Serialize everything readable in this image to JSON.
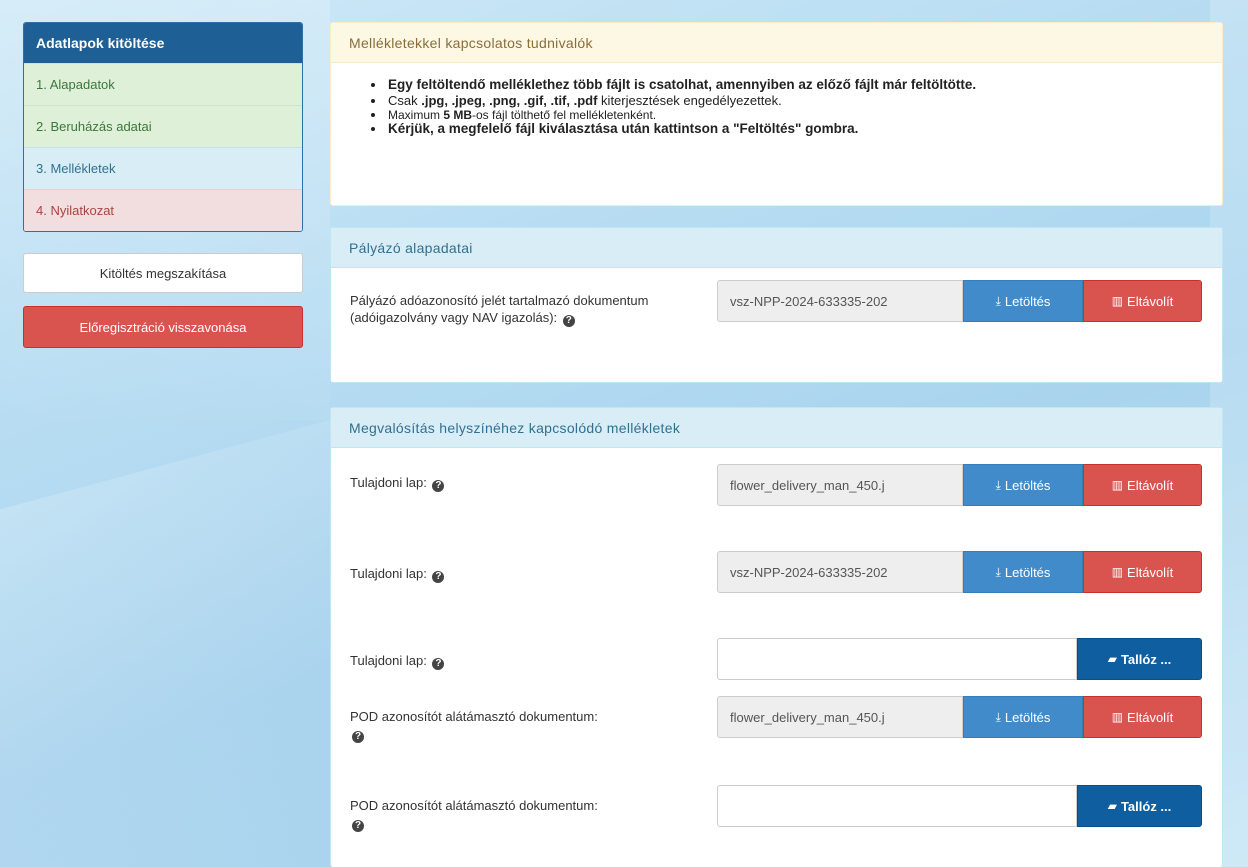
{
  "sidebar": {
    "header": "Adatlapok kitöltése",
    "steps": [
      "1. Alapadatok",
      "2. Beruházás adatai",
      "3. Mellékletek",
      "4. Nyilatkozat"
    ],
    "stop_button": "Kitöltés megszakítása",
    "revoke_button": "Előregisztráció visszavonása"
  },
  "info": {
    "title": "Mellékletekkel kapcsolatos tudnivalók",
    "item1": "Egy feltöltendő melléklethez több fájlt is csatolhat, amennyiben az előző fájlt már feltöltötte.",
    "item2_a": "Csak ",
    "item2_b": ".jpg, .jpeg, .png, .gif, .tif, .pdf",
    "item2_c": " kiterjesztések engedélyezettek.",
    "item3_a": "Maximum ",
    "item3_b": "5 MB",
    "item3_c": "-os fájl tölthető fel mellékletenként.",
    "item4": "Kérjük, a megfelelő fájl kiválasztása után kattintson a \"Feltöltés\" gombra."
  },
  "buttons": {
    "download": "Letöltés",
    "remove": "Eltávolít",
    "browse": "Tallóz ..."
  },
  "applicant": {
    "title": "Pályázó alapadatai",
    "label": "Pályázó adóazonosító jelét tartalmazó dokumentum (adóigazolvány vagy NAV igazolás):",
    "file": "vsz-NPP-2024-633335-202"
  },
  "location": {
    "title": "Megvalósítás helyszínéhez kapcsolódó mellékletek",
    "rows": [
      {
        "label": "Tulajdoni lap:",
        "file": "flower_delivery_man_450.j"
      },
      {
        "label": "Tulajdoni lap:",
        "file": "vsz-NPP-2024-633335-202"
      },
      {
        "label": "Tulajdoni lap:",
        "file": ""
      },
      {
        "label": "POD azonosítót alátámasztó dokumentum:",
        "file": "flower_delivery_man_450.j"
      },
      {
        "label": "POD azonosítót alátámasztó dokumentum:",
        "file": ""
      }
    ]
  },
  "icons": [
    "download-icon",
    "trash-icon",
    "folder-open-icon",
    "question-circle-icon"
  ],
  "colors": {
    "primary": "#428bca",
    "danger": "#d9534f",
    "browse": "#0f5fa0",
    "sidebar_header": "#1e5f96"
  }
}
